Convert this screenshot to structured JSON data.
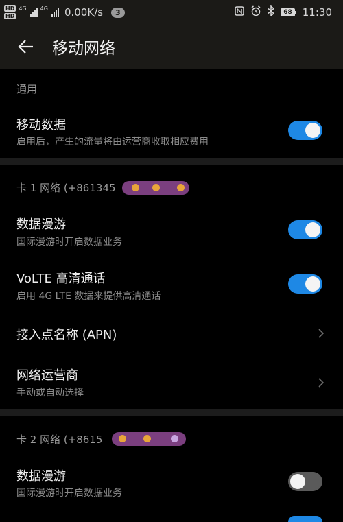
{
  "status_bar": {
    "hd_badges": [
      "HD",
      "HD"
    ],
    "network_labels": [
      "4G",
      "4G"
    ],
    "speed": "0.00K/s",
    "notification_count": "3",
    "battery": "68",
    "time": "11:30",
    "icons": [
      "nfc-icon",
      "alarm-icon",
      "bluetooth-icon",
      "battery-icon"
    ]
  },
  "app_bar": {
    "title": "移动网络",
    "back_icon": "arrow-left-icon"
  },
  "sections": [
    {
      "header": "通用",
      "items": [
        {
          "title": "移动数据",
          "subtitle": "启用后，产生的流量将由运营商收取相应费用",
          "control": "toggle",
          "state": "on"
        }
      ]
    },
    {
      "header": "卡 1 网络 (+861345",
      "items": [
        {
          "title": "数据漫游",
          "subtitle": "国际漫游时开启数据业务",
          "control": "toggle",
          "state": "on"
        },
        {
          "title": "VoLTE 高清通话",
          "subtitle": "启用 4G LTE 数据来提供高清通话",
          "control": "toggle",
          "state": "on"
        },
        {
          "title": "接入点名称 (APN)",
          "control": "chevron"
        },
        {
          "title": "网络运营商",
          "subtitle": "手动或自动选择",
          "control": "chevron"
        }
      ]
    },
    {
      "header": "卡 2 网络 (+8615",
      "items": [
        {
          "title": "数据漫游",
          "subtitle": "国际漫游时开启数据业务",
          "control": "toggle",
          "state": "off"
        }
      ]
    }
  ],
  "colors": {
    "accent": "#1e88e5",
    "background": "#000000",
    "bar": "#1b1a17",
    "toggle_off": "#5a5a5a"
  }
}
